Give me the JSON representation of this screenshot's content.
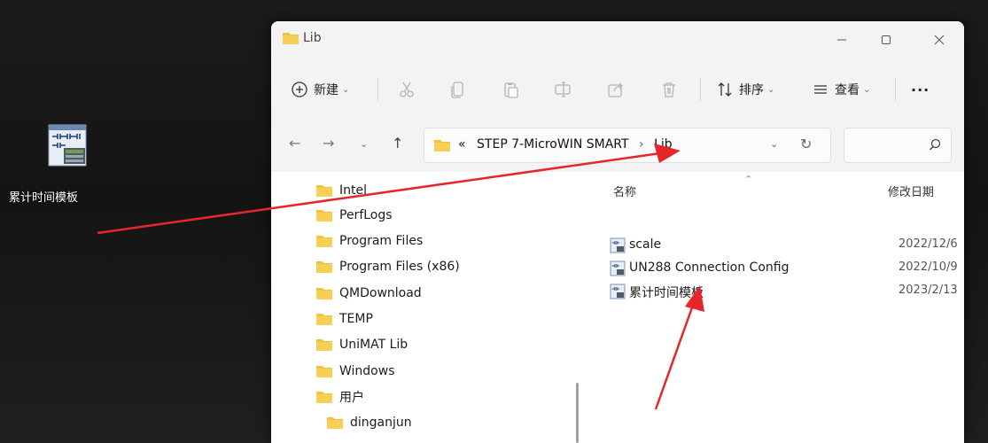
{
  "desktop": {
    "icon_label": "累计时间模板",
    "icon_name": "ladder-library-icon"
  },
  "window": {
    "title": "Lib",
    "controls": {
      "minimize": "minimize-icon",
      "maximize": "maximize-icon",
      "close": "close-icon"
    }
  },
  "toolbar": {
    "new_label": "新建",
    "sort_label": "排序",
    "view_label": "查看",
    "more_label": "···"
  },
  "address": {
    "overflow": "«",
    "crumbs": [
      "STEP 7-MicroWIN SMART",
      "Lib"
    ]
  },
  "nav": {
    "items": [
      "Intel",
      "PerfLogs",
      "Program Files",
      "Program Files (x86)",
      "QMDownload",
      "TEMP",
      "UniMAT Lib",
      "Windows",
      "用户",
      "dinganjun"
    ]
  },
  "content": {
    "col_name": "名称",
    "col_date": "修改日期",
    "files": [
      {
        "name": "scale",
        "date": "2022/12/6"
      },
      {
        "name": "UN288 Connection Config",
        "date": "2022/10/9"
      },
      {
        "name": "累计时间模板",
        "date": "2023/2/13"
      }
    ]
  },
  "colors": {
    "folder": "#f4c13b",
    "arrow": "#e8262a",
    "window_chrome": "#f3f3f3"
  }
}
